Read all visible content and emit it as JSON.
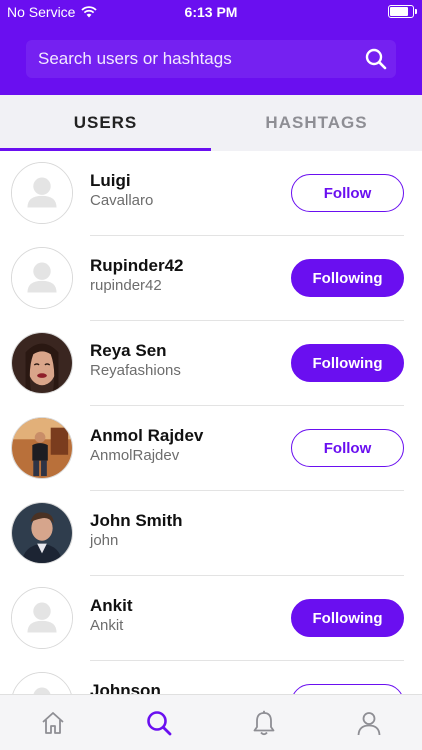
{
  "status_bar": {
    "carrier": "No Service",
    "time": "6:13 PM",
    "battery_level": 0.92
  },
  "search": {
    "placeholder": "Search users or hashtags"
  },
  "tabs": [
    {
      "label": "USERS",
      "active": true
    },
    {
      "label": "HASHTAGS",
      "active": false
    }
  ],
  "users": [
    {
      "name": "Luigi",
      "handle": "Cavallaro",
      "button": "Follow",
      "avatar": "placeholder-avatar"
    },
    {
      "name": "Rupinder42",
      "handle": "rupinder42",
      "button": "Following",
      "avatar": "placeholder-avatar"
    },
    {
      "name": "Reya Sen",
      "handle": "Reyafashions",
      "button": "Following",
      "avatar": "photo-avatar"
    },
    {
      "name": "Anmol Rajdev",
      "handle": "AnmolRajdev",
      "button": "Follow",
      "avatar": "photo-avatar"
    },
    {
      "name": "John Smith",
      "handle": "john",
      "button": "",
      "avatar": "photo-avatar"
    },
    {
      "name": "Ankit",
      "handle": "Ankit",
      "button": "Following",
      "avatar": "placeholder-avatar"
    },
    {
      "name": "Johnson",
      "handle": "",
      "button": "",
      "avatar": "placeholder-avatar"
    }
  ],
  "bottom_nav": [
    {
      "icon": "home-icon",
      "active": false
    },
    {
      "icon": "search-icon",
      "active": true
    },
    {
      "icon": "bell-icon",
      "active": false
    },
    {
      "icon": "profile-icon",
      "active": false
    }
  ],
  "colors": {
    "accent": "#6a0ff0",
    "tab_bar": "#f1f1f5",
    "inactive_icon": "#8e8e94"
  }
}
